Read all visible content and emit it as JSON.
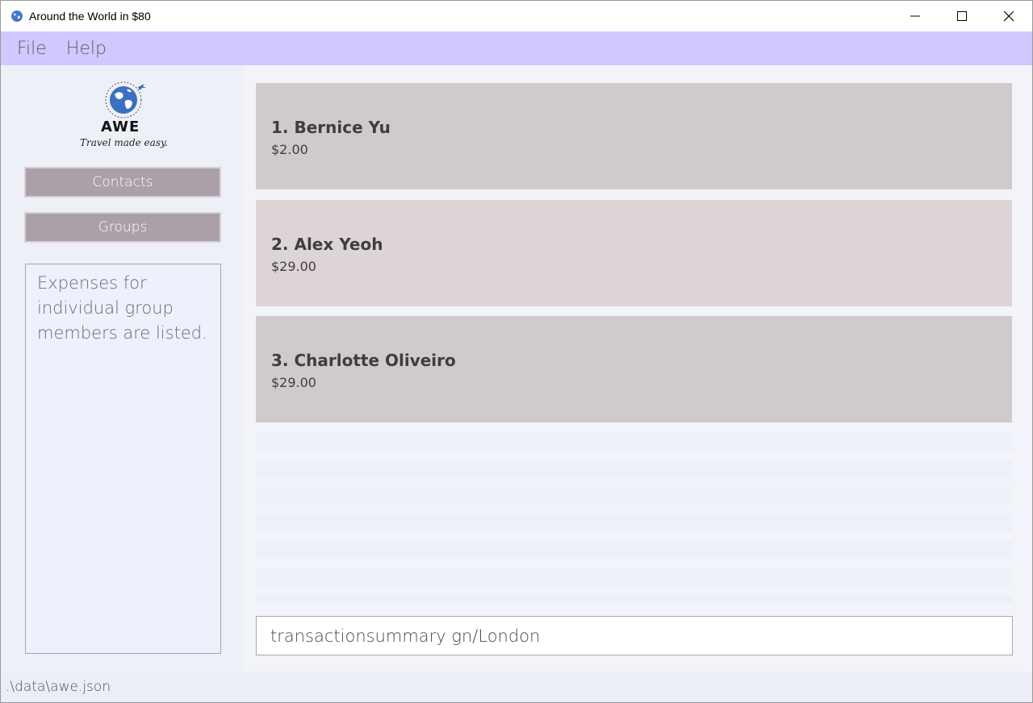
{
  "window": {
    "title": "Around the World in $80"
  },
  "menu": {
    "items": [
      "File",
      "Help"
    ]
  },
  "sidebar": {
    "logo_text": "AWE",
    "logo_tagline": "Travel made easy.",
    "buttons": {
      "contacts": "Contacts",
      "groups": "Groups"
    },
    "result_message": "Expenses for individual group members are listed."
  },
  "members": [
    {
      "name": "1. Bernice Yu",
      "amount": "$2.00"
    },
    {
      "name": "2. Alex Yeoh",
      "amount": "$29.00"
    },
    {
      "name": "3. Charlotte Oliveiro",
      "amount": "$29.00"
    }
  ],
  "command": {
    "value": "transactionsummary gn/London"
  },
  "status": {
    "file_path": ".\\data\\awe.json"
  },
  "colors": {
    "menubar": "#d0c8fe",
    "nav_button": "#aba0a7",
    "card_odd": "#cfcacb",
    "card_even": "#ddd4d6"
  }
}
